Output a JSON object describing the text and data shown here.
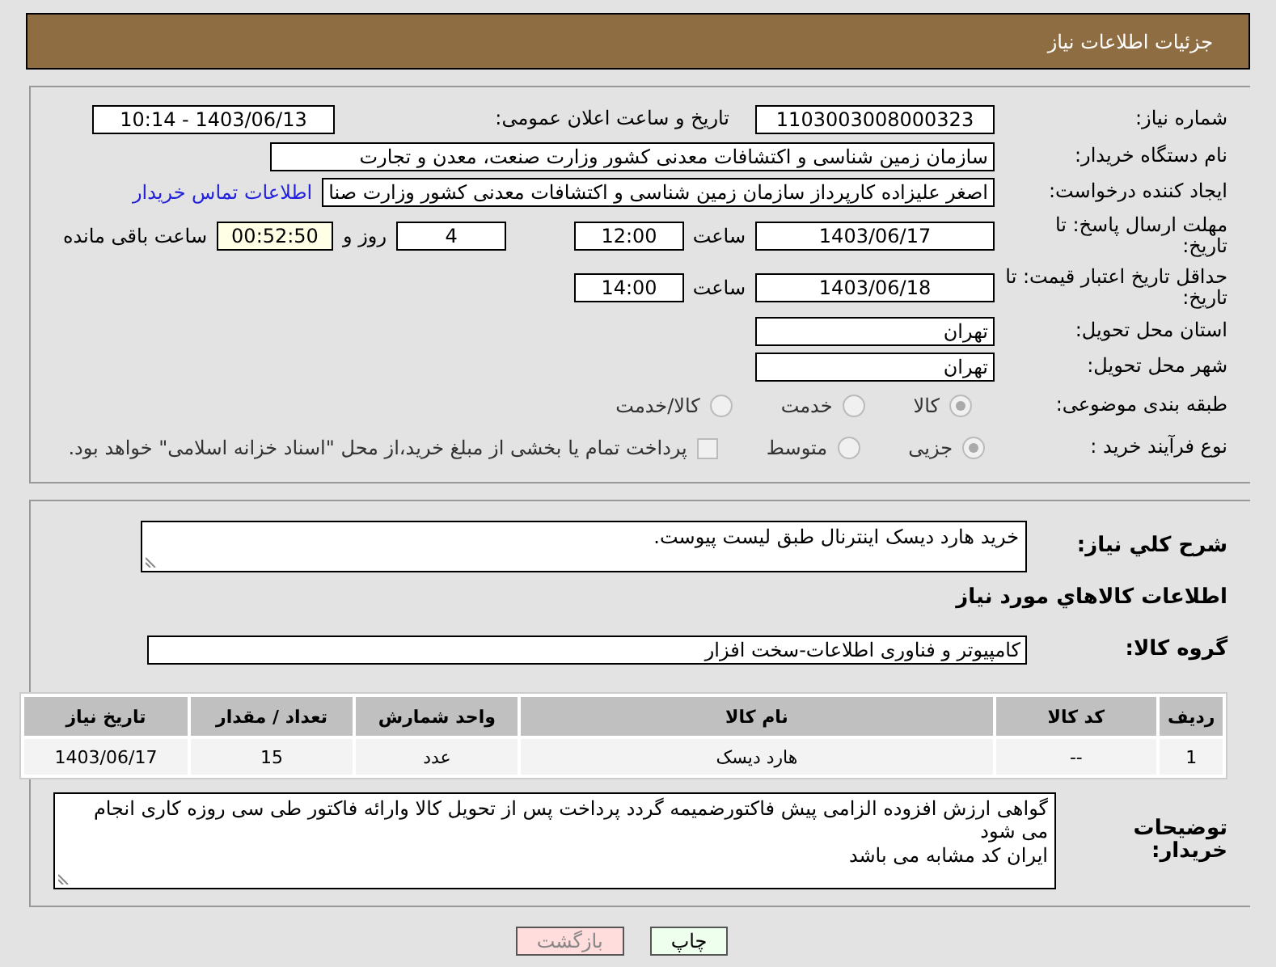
{
  "header": {
    "title": "جزئیات اطلاعات نیاز"
  },
  "info": {
    "need_number": {
      "label": "شماره نیاز:",
      "value": "1103003008000323"
    },
    "announce": {
      "label": "تاریخ و ساعت اعلان عمومی:",
      "value": "1403/06/13 - 10:14"
    },
    "buyer_org": {
      "label": "نام دستگاه خریدار:",
      "value": "سازمان زمین شناسی و اکتشافات معدنی کشور وزارت صنعت، معدن و تجارت"
    },
    "creator": {
      "label": "ایجاد کننده درخواست:",
      "value": "اصغر علیزاده کارپرداز سازمان زمین شناسی و اکتشافات معدنی کشور وزارت صنا",
      "link": "اطلاعات تماس خریدار"
    },
    "reply_deadline": {
      "label": "مهلت ارسال پاسخ: تا تاریخ:",
      "date": "1403/06/17",
      "time_label": "ساعت",
      "time": "12:00",
      "days": "4",
      "days_label": "روز و",
      "remaining": "00:52:50",
      "remaining_label": "ساعت باقی مانده"
    },
    "price_validity": {
      "label": "حداقل تاریخ اعتبار قیمت: تا تاریخ:",
      "date": "1403/06/18",
      "time_label": "ساعت",
      "time": "14:00"
    },
    "province": {
      "label": "استان محل تحویل:",
      "value": "تهران"
    },
    "city": {
      "label": "شهر محل تحویل:",
      "value": "تهران"
    },
    "category": {
      "label": "طبقه بندی موضوعی:",
      "options": [
        {
          "label": "کالا",
          "selected": true
        },
        {
          "label": "خدمت",
          "selected": false
        },
        {
          "label": "کالا/خدمت",
          "selected": false
        }
      ]
    },
    "process": {
      "label": "نوع فرآیند خرید :",
      "options": [
        {
          "label": "جزیی",
          "selected": true
        },
        {
          "label": "متوسط",
          "selected": false
        }
      ],
      "treasury": {
        "label": "پرداخت تمام یا بخشی از مبلغ خرید،از محل \"اسناد خزانه اسلامی\" خواهد بود.",
        "checked": false
      }
    }
  },
  "details": {
    "summary": {
      "label": "شرح کلي نياز:",
      "value": "خرید هارد دیسک اینترنال طبق لیست پیوست."
    },
    "goods_heading": "اطلاعات کالاهاي مورد نياز",
    "goods_group": {
      "label": "گروه کالا:",
      "value": "کامپیوتر و فناوری اطلاعات-سخت افزار"
    },
    "table": {
      "columns": [
        "ردیف",
        "کد کالا",
        "نام کالا",
        "واحد شمارش",
        "تعداد / مقدار",
        "تاریخ نیاز"
      ],
      "rows": [
        [
          "1",
          "--",
          "هارد دیسک",
          "عدد",
          "15",
          "1403/06/17"
        ]
      ]
    },
    "notes": {
      "label": "توضیحات خریدار:",
      "lines": [
        "گواهی ارزش افزوده الزامی پیش فاکتورضمیمه گردد پرداخت پس از تحویل کالا وارائه فاکتور طی سی روزه کاری انجام می شود",
        "ایران کد مشابه می باشد"
      ]
    }
  },
  "buttons": [
    {
      "label": "چاپ",
      "color": "#eeffee",
      "disabled": false
    },
    {
      "label": "بازگشت",
      "color": "#ffdddd",
      "disabled": true
    }
  ]
}
